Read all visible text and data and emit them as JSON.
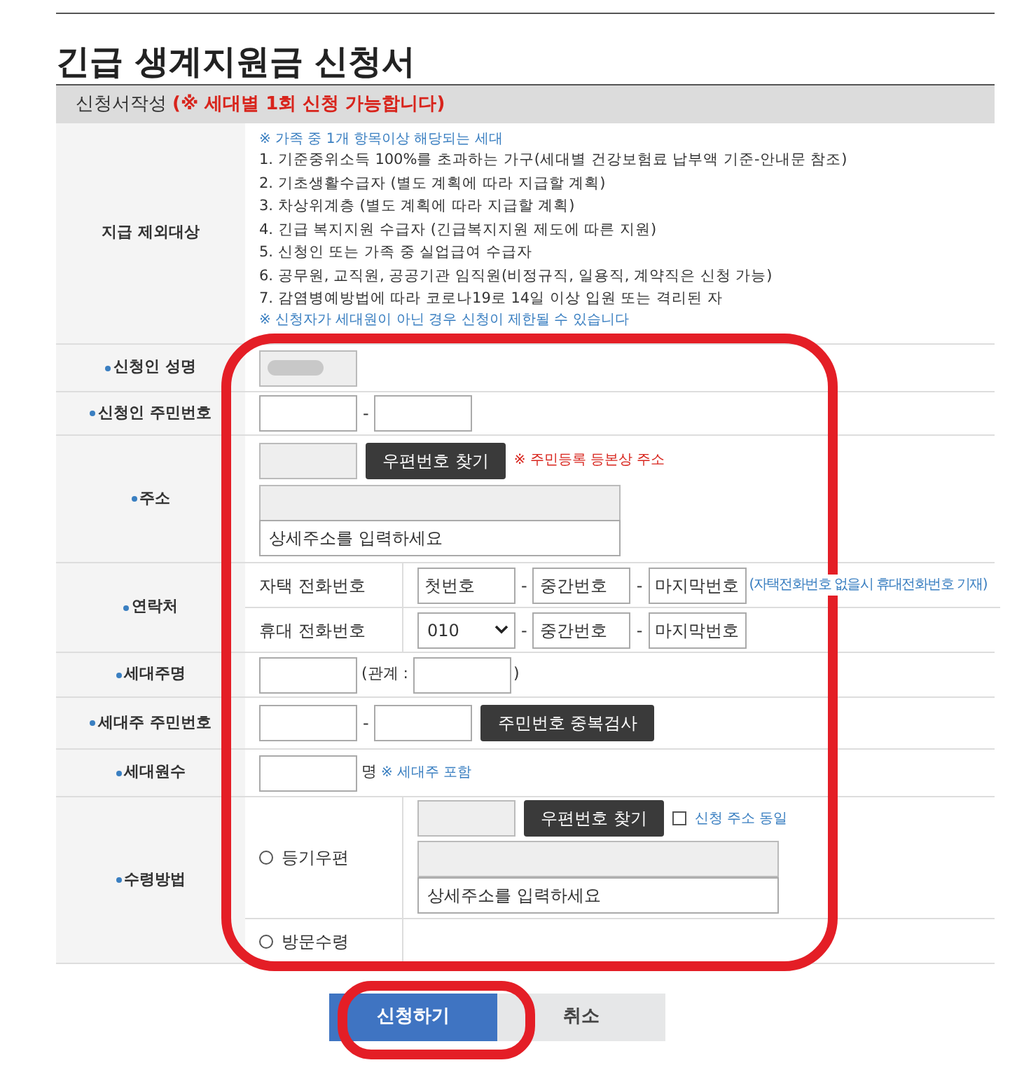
{
  "title": "긴급 생계지원금 신청서",
  "section": {
    "label": "신청서작성",
    "notice": "(※ 세대별 1회 신청 가능합니다)"
  },
  "exclusions": {
    "label": "지급 제외대상",
    "intro": "※ 가족 중 1개 항목이상 해당되는 세대",
    "items": [
      "1. 기준중위소득 100%를 초과하는 가구(세대별 건강보험료 납부액 기준-안내문 참조)",
      "2. 기초생활수급자 (별도 계획에 따라 지급할 계획)",
      "3. 차상위계층 (별도 계획에 따라 지급할 계획)",
      "4. 긴급 복지지원 수급자 (긴급복지지원 제도에 따른 지원)",
      "5. 신청인 또는 가족 중 실업급여 수급자",
      "6. 공무원, 교직원, 공공기관 임직원(비정규직, 일용직, 계약직은 신청 가능)",
      "7. 감염병예방법에 따라 코로나19로 14일 이상 입원 또는 격리된 자"
    ],
    "footer": "※ 신청자가 세대원이 아닌 경우 신청이 제한될 수 있습니다"
  },
  "applicant_name": {
    "label": "신청인 성명",
    "redacted": true
  },
  "applicant_rrn": {
    "label": "신청인 주민번호",
    "separator": "-"
  },
  "address": {
    "label": "주소",
    "button": "우편번호 찾기",
    "note": "※ 주민등록 등본상 주소",
    "detail_placeholder": "상세주소를 입력하세요"
  },
  "contact": {
    "label": "연락처",
    "rows": [
      {
        "kind": "home",
        "label": "자택 전화번호",
        "first_placeholder": "첫번호",
        "middle_placeholder": "중간번호",
        "last_placeholder": "마지막번호",
        "separator": "-",
        "note": "(자택전화번호 없을시 휴대전화번호 기재)"
      },
      {
        "kind": "mobile",
        "label": "휴대 전화번호",
        "first_value": "010",
        "middle_placeholder": "중간번호",
        "last_placeholder": "마지막번호",
        "separator": "-"
      }
    ]
  },
  "household_head": {
    "label": "세대주명",
    "relation_label": "(관계 :",
    "relation_close": ")"
  },
  "household_head_rrn": {
    "label": "세대주 주민번호",
    "separator": "-",
    "button": "주민번호 중복검사"
  },
  "household_count": {
    "label": "세대원수",
    "unit": "명",
    "note": "※ 세대주 포함"
  },
  "receipt": {
    "label": "수령방법",
    "options": [
      {
        "kind": "mail",
        "label": "등기우편",
        "selected": false,
        "button": "우편번호 찾기",
        "same_label": "신청 주소 동일",
        "same_checked": false,
        "detail_placeholder": "상세주소를 입력하세요"
      },
      {
        "kind": "visit",
        "label": "방문수령",
        "selected": false
      }
    ]
  },
  "buttons": [
    {
      "kind": "primary",
      "label": "신청하기"
    },
    {
      "kind": "secondary",
      "label": "취소"
    }
  ]
}
